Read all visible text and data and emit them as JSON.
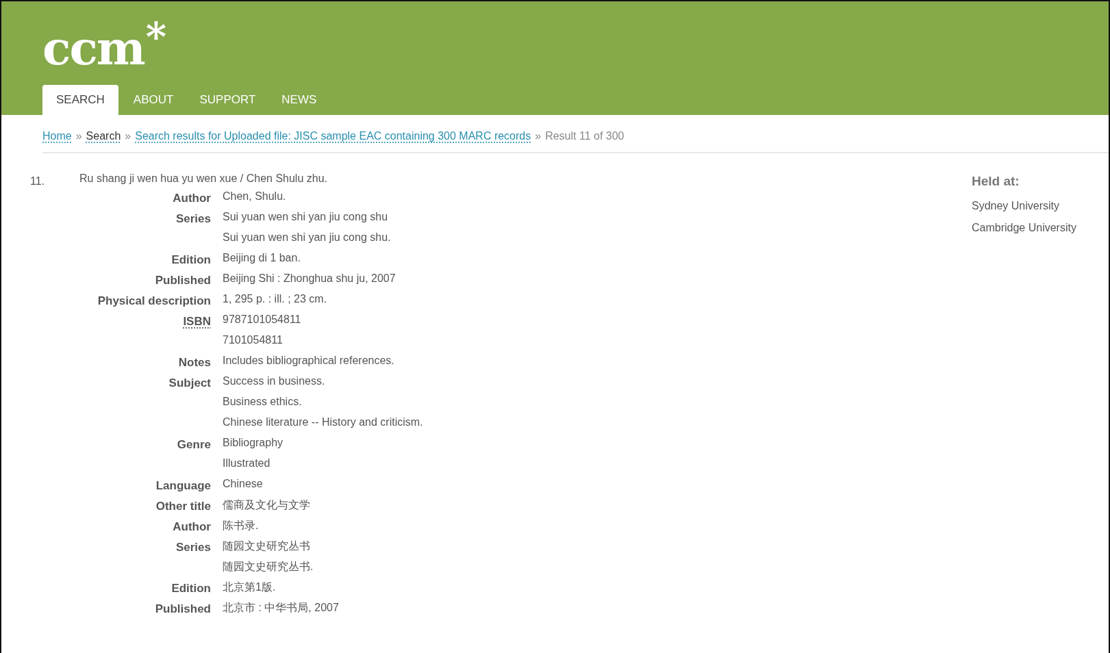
{
  "header": {
    "logo": "ccm",
    "logo_mark": "*",
    "tabs": [
      {
        "label": "SEARCH",
        "selected": true
      },
      {
        "label": "ABOUT",
        "selected": false
      },
      {
        "label": "SUPPORT",
        "selected": false
      },
      {
        "label": "NEWS",
        "selected": false
      }
    ]
  },
  "breadcrumb": [
    {
      "kind": "link",
      "text": "Home"
    },
    {
      "kind": "separator",
      "text": "»"
    },
    {
      "kind": "link",
      "text": "Search"
    },
    {
      "kind": "separator",
      "text": "»"
    },
    {
      "kind": "link",
      "text": "Search results for Uploaded file: JISC sample EAC containing 300 MARC records"
    },
    {
      "kind": "separator",
      "text": "»"
    },
    {
      "kind": "text",
      "text": "Result 11 of 300"
    }
  ],
  "record": {
    "number": "11.",
    "title": "Ru shang ji wen hua yu wen xue / Chen Shulu zhu.",
    "fields": [
      {
        "label": "Author",
        "abbr": false,
        "values": [
          "Chen, Shulu."
        ]
      },
      {
        "label": "Series",
        "abbr": false,
        "values": [
          "Sui yuan wen shi yan jiu cong shu",
          "Sui yuan wen shi yan jiu cong shu."
        ]
      },
      {
        "label": "Edition",
        "abbr": false,
        "values": [
          "Beijing di 1 ban."
        ]
      },
      {
        "label": "Published",
        "abbr": false,
        "values": [
          "Beijing Shi : Zhonghua shu ju, 2007"
        ]
      },
      {
        "label": "Physical description",
        "abbr": false,
        "values": [
          "1, 295 p. : ill. ; 23 cm."
        ]
      },
      {
        "label": "ISBN",
        "abbr": true,
        "values": [
          "9787101054811",
          "7101054811"
        ]
      },
      {
        "label": "Notes",
        "abbr": false,
        "values": [
          "Includes bibliographical references."
        ]
      },
      {
        "label": "Subject",
        "abbr": false,
        "values": [
          "Success in business.",
          "Business ethics.",
          "Chinese literature -- History and criticism."
        ]
      },
      {
        "label": "Genre",
        "abbr": false,
        "values": [
          "Bibliography",
          "Illustrated"
        ]
      },
      {
        "label": "Language",
        "abbr": false,
        "values": [
          "Chinese"
        ]
      },
      {
        "label": "Other title",
        "abbr": false,
        "values": [
          "儒商及文化与文学"
        ]
      },
      {
        "label": "Author",
        "abbr": false,
        "values": [
          "陈书录."
        ]
      },
      {
        "label": "Series",
        "abbr": false,
        "values": [
          "随园文史研究丛书",
          "随园文史研究丛书."
        ]
      },
      {
        "label": "Edition",
        "abbr": false,
        "values": [
          "北京第1版."
        ]
      },
      {
        "label": "Published",
        "abbr": false,
        "values": [
          "北京市 : 中华书局, 2007"
        ]
      }
    ]
  },
  "held_at": {
    "heading": "Held at:",
    "libraries": [
      "Sydney University",
      "Cambridge University"
    ]
  }
}
